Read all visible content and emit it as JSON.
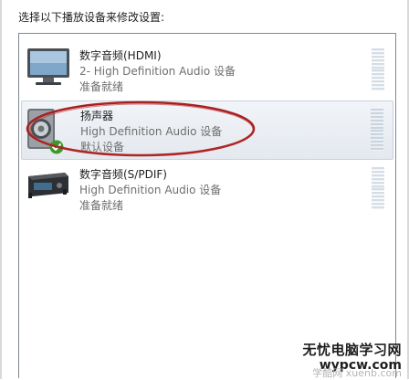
{
  "header": {
    "instruction": "选择以下播放设备来修改设置:"
  },
  "devices": [
    {
      "name": "数字音频(HDMI)",
      "description": "2- High Definition Audio 设备",
      "status": "准备就绪",
      "icon": "monitor-icon",
      "selected": false
    },
    {
      "name": "扬声器",
      "description": "High Definition Audio 设备",
      "status": "默认设备",
      "icon": "speaker-icon",
      "selected": true,
      "badge_icon": "default-checkmark-icon"
    },
    {
      "name": "数字音频(S/PDIF)",
      "description": "High Definition Audio 设备",
      "status": "准备就绪",
      "icon": "digital-output-icon",
      "selected": false
    }
  ],
  "annotation": {
    "shape": "ellipse",
    "color": "#a82020"
  },
  "watermark": {
    "title": "无忧电脑学习网",
    "url": "wypcw.com",
    "faint_text": "学酷网 xuenb.com"
  }
}
